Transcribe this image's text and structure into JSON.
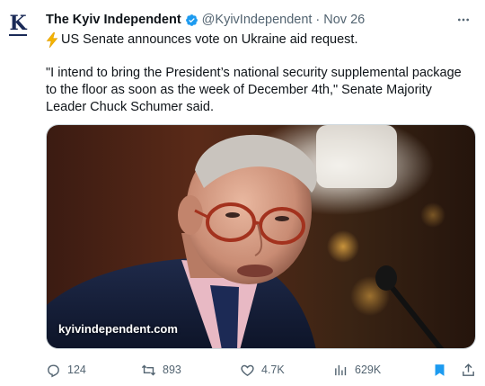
{
  "tweet": {
    "author_name": "The Kyiv Independent",
    "handle": "@KyivIndependent",
    "separator": "·",
    "date": "Nov 26",
    "avatar_letter": "K",
    "headline": "US Senate announces vote on Ukraine aid request.",
    "headline_icon": "lightning-icon",
    "body": "\"I intend to bring the President’s national security supplemental package to the floor as soon as the week of December 4th,\" Senate Majority Leader Chuck Schumer said.",
    "image_watermark": "kyivindependent.com"
  },
  "actions": {
    "replies": "124",
    "reposts": "893",
    "likes": "4.7K",
    "views": "629K"
  },
  "colors": {
    "accent": "#1d9bf0",
    "bookmark": "#1d9bf0",
    "text": "#0f1419",
    "muted": "#536471",
    "bolt": "#f4b400"
  }
}
